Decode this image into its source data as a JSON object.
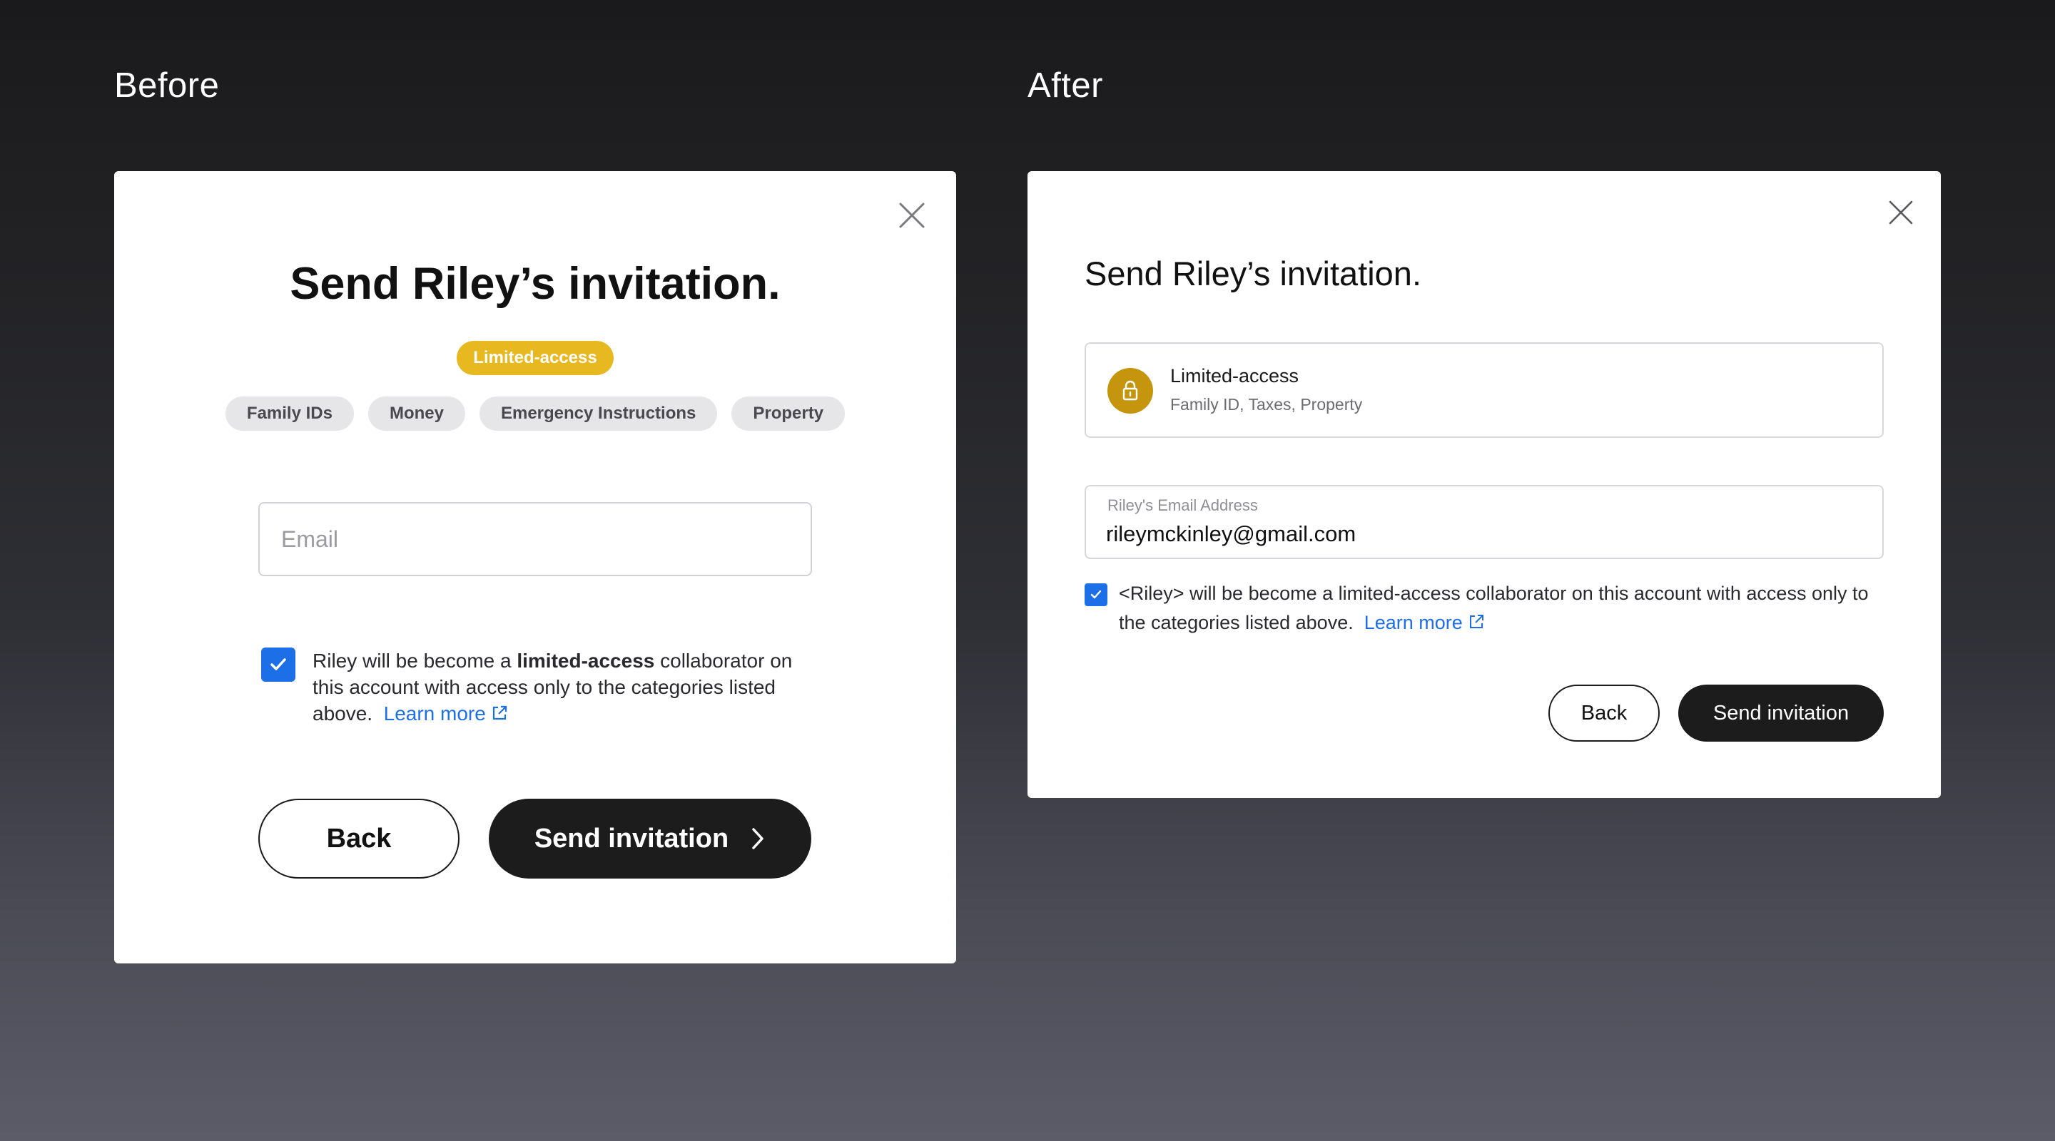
{
  "labels": {
    "before": "Before",
    "after": "After"
  },
  "before": {
    "close_icon": "close-icon",
    "title": "Send Riley’s invitation.",
    "badge": "Limited-access",
    "chips": [
      "Family IDs",
      "Money",
      "Emergency Instructions",
      "Property"
    ],
    "email": {
      "placeholder": "Email",
      "value": ""
    },
    "checkbox_checked": true,
    "consent": {
      "prefix": "Riley will be become a ",
      "bold": "limited-access",
      "suffix": " collaborator on this account with access only to the categories listed above.",
      "link": "Learn more"
    },
    "buttons": {
      "back": "Back",
      "send": "Send invitation"
    }
  },
  "after": {
    "close_icon": "close-icon",
    "title": "Send Riley’s invitation.",
    "access": {
      "icon": "lock-icon",
      "title": "Limited-access",
      "categories": "Family ID, Taxes, Property"
    },
    "email": {
      "label": "Riley's Email Address",
      "value": "rileymckinley@gmail.com"
    },
    "checkbox_checked": true,
    "consent": {
      "text": "<Riley> will be become a limited-access collaborator on this account with access only to the categories listed above.",
      "link": "Learn more"
    },
    "buttons": {
      "back": "Back",
      "send": "Send invitation"
    }
  },
  "colors": {
    "badge_yellow": "#e8b820",
    "lock_gold": "#c4950d",
    "checkbox_blue": "#1d6fe8",
    "link_blue": "#1d6fe8",
    "primary_button": "#1c1c1c"
  }
}
